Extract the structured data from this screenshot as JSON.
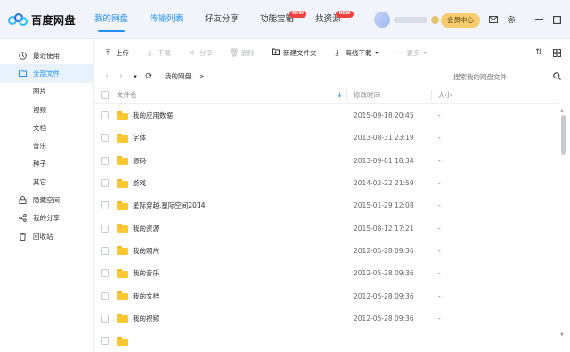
{
  "app": {
    "name": "百度网盘"
  },
  "nav": {
    "items": [
      {
        "label": "我的网盘",
        "active": true
      },
      {
        "label": "传输列表",
        "blue": true
      },
      {
        "label": "好友分享"
      },
      {
        "label": "功能宝箱",
        "badge": "NEW"
      },
      {
        "label": "找资源",
        "badge": "NEW"
      }
    ]
  },
  "user": {
    "vip_label": "会员中心"
  },
  "sidebar": {
    "items": [
      {
        "label": "最近使用",
        "icon": "clock-icon"
      },
      {
        "label": "全部文件",
        "icon": "folder-icon",
        "active": true
      },
      {
        "label": "图片",
        "sub": true
      },
      {
        "label": "视频",
        "sub": true
      },
      {
        "label": "文档",
        "sub": true
      },
      {
        "label": "音乐",
        "sub": true
      },
      {
        "label": "种子",
        "sub": true
      },
      {
        "label": "其它",
        "sub": true
      },
      {
        "label": "隐藏空间",
        "icon": "lock-icon"
      },
      {
        "label": "我的分享",
        "icon": "share-icon"
      },
      {
        "label": "回收站",
        "icon": "trash-icon"
      }
    ]
  },
  "toolbar": {
    "upload": "上传",
    "download": "下载",
    "share": "分享",
    "delete": "删除",
    "new_folder": "新建文件夹",
    "offline_download": "离线下载",
    "more": "更多"
  },
  "path": {
    "crumb": "我的网盘",
    "arrow": ">",
    "search_placeholder": "搜索我的网盘文件"
  },
  "table": {
    "headers": {
      "name": "文件名",
      "time": "修改时间",
      "size": "大小"
    },
    "rows": [
      {
        "name": "我的应用数据",
        "time": "2015-09-18 20:45",
        "size": "-"
      },
      {
        "name": "字体",
        "time": "2013-08-31 23:19",
        "size": "-"
      },
      {
        "name": "源码",
        "time": "2013-09-01 18:34",
        "size": "-"
      },
      {
        "name": "游戏",
        "time": "2014-02-22 21:59",
        "size": "-"
      },
      {
        "name": "星际穿越.星际空间2014",
        "time": "2015-01-29 12:08",
        "size": "-"
      },
      {
        "name": "我的资源",
        "time": "2015-08-12 17:21",
        "size": "-"
      },
      {
        "name": "我的照片",
        "time": "2012-05-28 09:36",
        "size": "-"
      },
      {
        "name": "我的音乐",
        "time": "2012-05-28 09:36",
        "size": "-"
      },
      {
        "name": "我的文档",
        "time": "2012-05-28 09:36",
        "size": "-"
      },
      {
        "name": "我的视频",
        "time": "2012-05-28 09:36",
        "size": "-"
      },
      {
        "name": "",
        "time": "",
        "size": ""
      }
    ]
  },
  "colors": {
    "accent": "#1f8ff3",
    "vip": "#f6cc6e",
    "folder": "#fcc733"
  }
}
